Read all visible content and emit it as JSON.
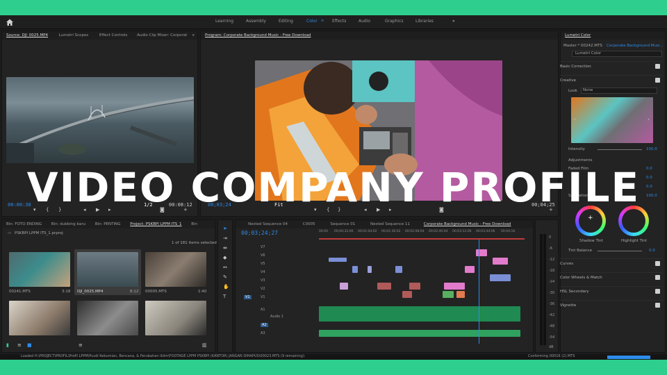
{
  "overlay_title": "VIDEO COMPANY PROFILE",
  "workspaces": [
    "Learning",
    "Assembly",
    "Editing",
    "Color",
    "Effects",
    "Audio",
    "Graphics",
    "Libraries"
  ],
  "workspaces_more": "»",
  "source_tabs": [
    "Source: DJI_0025.MP4",
    "Lumetri Scopes",
    "Effect Controls",
    "Audio Clip Mixer: Corporat"
  ],
  "source_more": "»",
  "source_timecode": "00:00:38",
  "source_duration": "00:08:12",
  "source_fraction": "1/2",
  "program_title": "Program: Corporate Background Music - Free Download",
  "program_timecode": "00;03;24",
  "program_fit": "Fit",
  "program_duration": "00;04;25",
  "project_tabs": [
    "Bin: FOTO ENDING",
    "Bin: dubbing baru",
    "Bin: PENTING",
    "Project: PSKBPI LPPM ITS_1",
    "Bin"
  ],
  "project_file": "PSKBPI LPPM ITS_1.prproj",
  "items_selected": "1 of 181 items selected",
  "media": [
    {
      "name": "00241.MTS",
      "dur": "3:18"
    },
    {
      "name": "DJI_0025.MP4",
      "dur": "8:12"
    },
    {
      "name": "00005.MTS",
      "dur": "1:40"
    },
    {
      "name": "",
      "dur": ""
    },
    {
      "name": "",
      "dur": ""
    },
    {
      "name": "",
      "dur": ""
    }
  ],
  "timeline_tabs": [
    "Nested Sequence 04",
    "C0005",
    "Sequence 01",
    "Nested Sequence 11",
    "Corporate Background Music - Free Download"
  ],
  "timeline_timecode": "00;03;24;27",
  "ruler": [
    "00;00",
    "00;00;32;00",
    "00;01;04;02",
    "00;01;36;02",
    "00;02;08;04",
    "00;02;40;04",
    "00;03;12;06",
    "00;03;44;06",
    "00;04;16"
  ],
  "video_tracks": [
    "V7",
    "V6",
    "V5",
    "V4",
    "V3",
    "V2",
    "V1"
  ],
  "audio_tracks": [
    "A1",
    "A2",
    "A3"
  ],
  "audio_label": "Audio 1",
  "meter_labels": [
    "0",
    "-6",
    "-12",
    "-18",
    "-24",
    "-30",
    "-36",
    "-42",
    "-48",
    "-54",
    "dB"
  ],
  "lumetri": {
    "title": "Lumetri Color",
    "master": "Master * 00242.MTS",
    "clip": "Corporate Background Musi...",
    "effect": "Lumetri Color",
    "basic": "Basic Correction",
    "creative": "Creative",
    "look_label": "Look",
    "look_value": "None",
    "intensity_label": "Intensity",
    "intensity_value": "100.0",
    "adjustments": "Adjustments",
    "faded_film": "Faded Film",
    "faded_value": "0.0",
    "sharpen_value": "0.0",
    "vibrance_value": "0.0",
    "saturation_label": "Saturation",
    "saturation_value": "100.0",
    "shadow_tint": "Shadow Tint",
    "highlight_tint": "Highlight Tint",
    "tint_balance": "Tint Balance",
    "tint_value": "0.0",
    "sections": [
      "Curves",
      "Color Wheels & Match",
      "HSL Secondary",
      "Vignette"
    ]
  },
  "status_text": "Loaded H:\\PROJECT\\PROFIL\\Profil LPPM\\Pusdi Kebumian, Bencana, & Perubahan Iklim\\FOOTAGE LPPM PSKBPI (KANTOR) JANGAN DIHAPUS\\00023.MTS (9 remaining).",
  "conforming": "Conforming 00016 (2).MTS",
  "colors": {
    "accent": "#2d8ceb",
    "frame": "#2ecf8e",
    "title": "#ffffff"
  }
}
